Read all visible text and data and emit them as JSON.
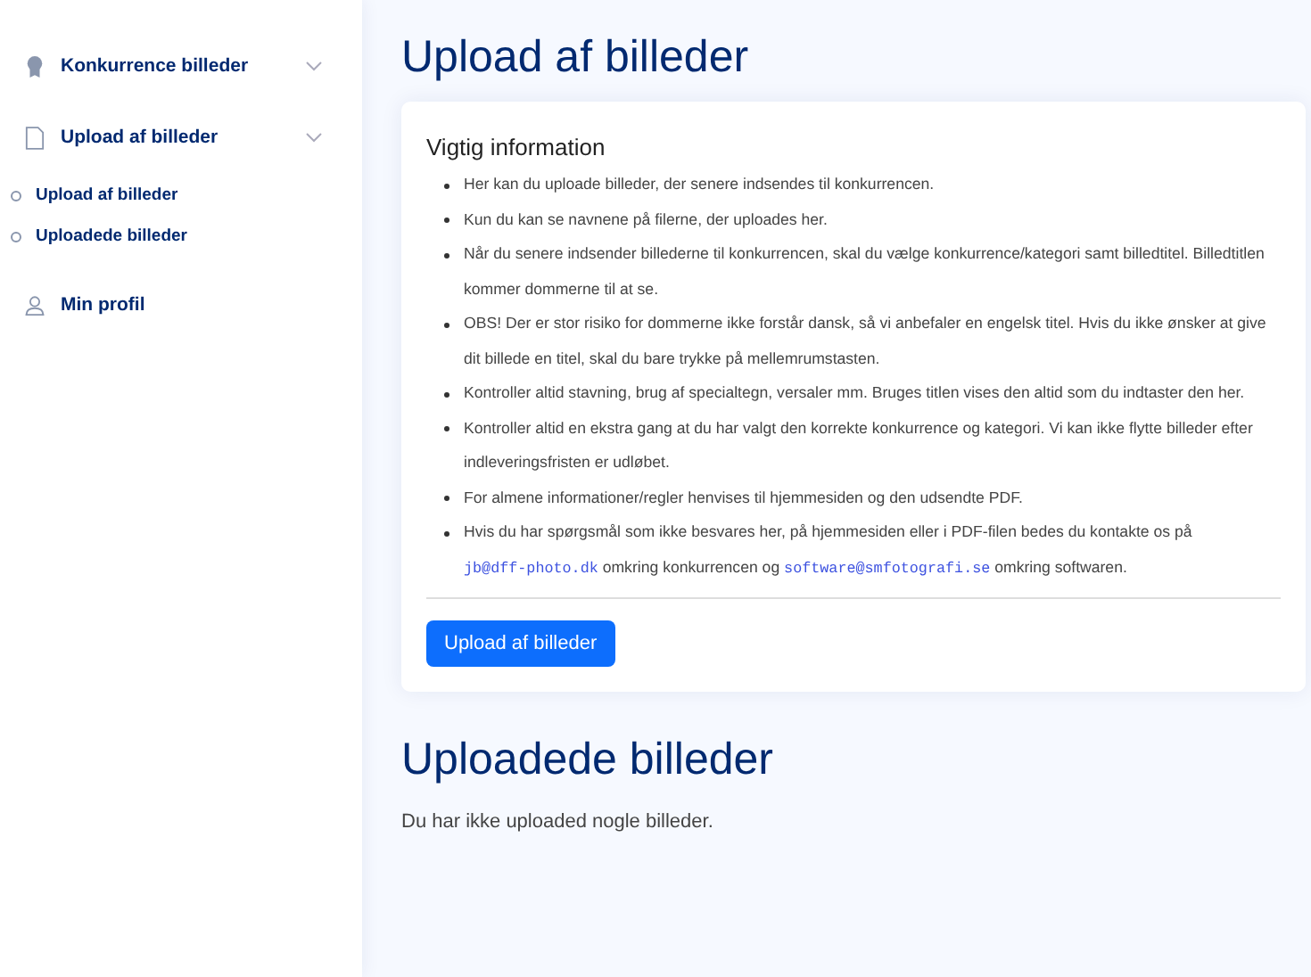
{
  "sidebar": {
    "items": [
      {
        "label": "Konkurrence billeder",
        "kind": "group"
      },
      {
        "label": "Upload af billeder",
        "kind": "group",
        "children": [
          {
            "label": "Upload af billeder"
          },
          {
            "label": "Uploadede billeder"
          }
        ]
      },
      {
        "label": "Min profil",
        "kind": "link"
      }
    ]
  },
  "page_title": "Upload af billeder",
  "info_card": {
    "title": "Vigtig information",
    "items": [
      [
        {
          "kind": "text",
          "text": "Her kan du uploade billeder, der senere indsendes til konkurrencen."
        }
      ],
      [
        {
          "kind": "text",
          "text": "Kun du kan se navnene på filerne, der uploades her."
        }
      ],
      [
        {
          "kind": "text",
          "text": "Når du senere indsender billederne til konkurrencen, skal du vælge konkurrence/kategori samt billedtitel. Billedtitlen kommer dommerne til at se."
        }
      ],
      [
        {
          "kind": "text",
          "text": "OBS! Der er stor risiko for dommerne ikke forstår dansk, så vi anbefaler en engelsk titel. Hvis du ikke ønsker at give dit billede en titel, skal du bare trykke på mellemrumstasten."
        }
      ],
      [
        {
          "kind": "text",
          "text": "Kontroller altid stavning, brug af specialtegn, versaler mm. Bruges titlen vises den altid som du indtaster den her."
        }
      ],
      [
        {
          "kind": "text",
          "text": "Kontroller altid en ekstra gang at du har valgt den korrekte konkurrence og kategori. Vi kan ikke flytte billeder efter indleveringsfristen er udløbet."
        }
      ],
      [
        {
          "kind": "text",
          "text": "For almene informationer/regler henvises til hjemmesiden og den udsendte PDF."
        }
      ],
      [
        {
          "kind": "text",
          "text": "Hvis du har spørgsmål som ikke besvares her, på hjemmesiden eller i PDF-filen bedes du kontakte os på "
        },
        {
          "kind": "email",
          "text": "jb@dff-photo.dk"
        },
        {
          "kind": "text",
          "text": " omkring konkurrencen og "
        },
        {
          "kind": "email",
          "text": "software@smfotografi.se"
        },
        {
          "kind": "text",
          "text": " omkring softwaren."
        }
      ]
    ],
    "button": "Upload af billeder"
  },
  "uploaded": {
    "title": "Uploadede billeder",
    "empty_text": "Du har ikke uploaded nogle billeder."
  }
}
